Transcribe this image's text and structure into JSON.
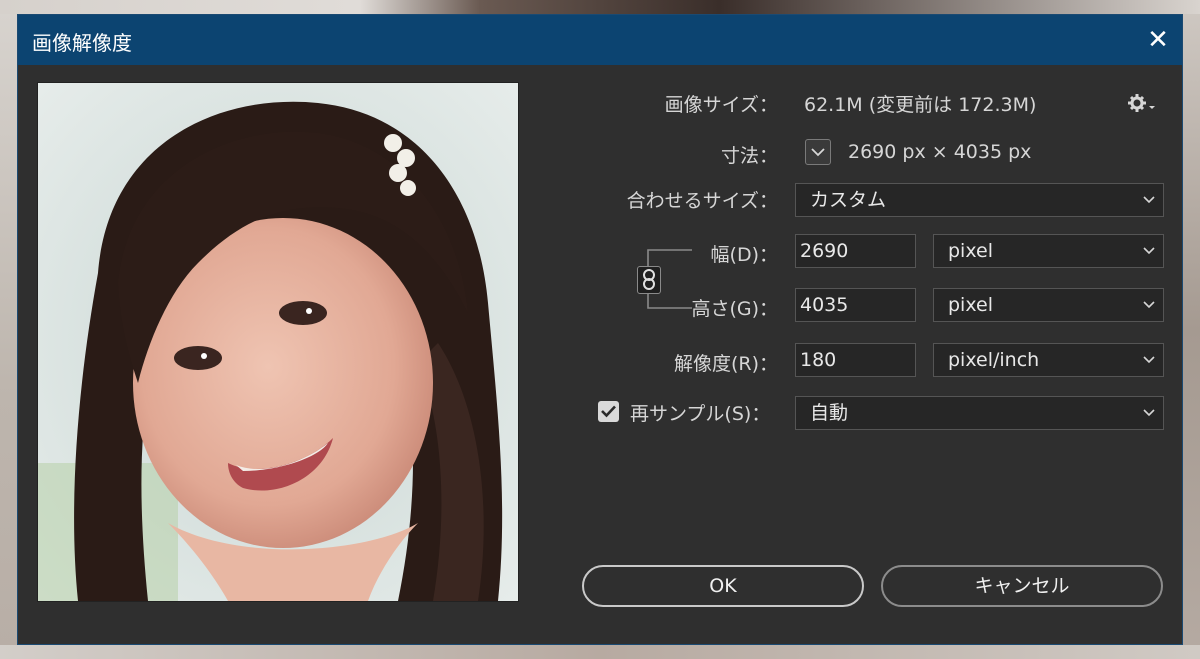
{
  "window": {
    "title": "画像解像度",
    "close_symbol": "✕"
  },
  "image_size": {
    "label": "画像サイズ：",
    "value": "62.1M (変更前は 172.3M)"
  },
  "settings_icon": "gear-icon",
  "dimensions": {
    "label": "寸法：",
    "value": "2690 px × 4035 px"
  },
  "fit_to": {
    "label": "合わせるサイズ：",
    "value": "カスタム"
  },
  "width": {
    "label": "幅(D)：",
    "value": "2690",
    "unit": "pixel"
  },
  "height": {
    "label": "高さ(G)：",
    "value": "4035",
    "unit": "pixel"
  },
  "resolution": {
    "label": "解像度(R)：",
    "value": "180",
    "unit": "pixel/inch"
  },
  "resample": {
    "label": "再サンプル(S)：",
    "checked": true,
    "value": "自動"
  },
  "buttons": {
    "ok": "OK",
    "cancel": "キャンセル"
  },
  "colors": {
    "titlebar": "#0c4471",
    "dialog_bg": "#2f2f2f",
    "text": "#d6d6d6"
  }
}
